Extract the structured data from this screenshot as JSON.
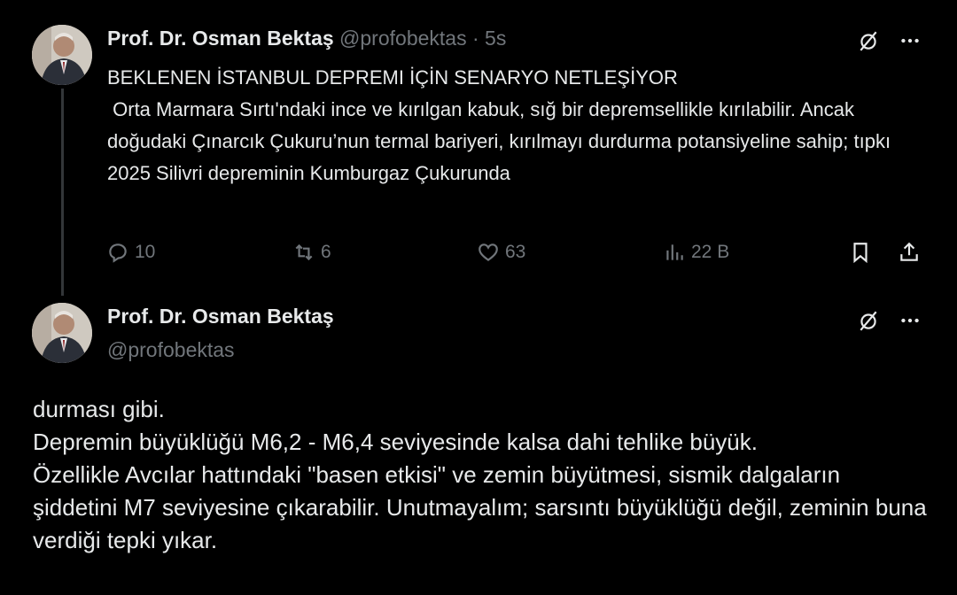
{
  "tweet1": {
    "author_name": "Prof. Dr. Osman Bektaş",
    "author_handle": "@profobektas",
    "separator": "·",
    "time": "5s",
    "title": "BEKLENEN İSTANBUL DEPREMI İÇİN SENARYO NETLEŞİYOR",
    "body": " Orta Marmara Sırtı'ndaki ince ve kırılgan kabuk, sığ bir depremsellikle kırılabilir. Ancak doğudaki Çınarcık Çukuru’nun termal bariyeri, kırılmayı durdurma potansiyeline sahip; tıpkı 2025 Silivri depreminin Kumburgaz Çukurunda",
    "replies": "10",
    "reposts": "6",
    "likes": "63",
    "views": "22 B"
  },
  "tweet2": {
    "author_name": "Prof. Dr. Osman Bektaş",
    "author_handle": "@profobektas",
    "body": "durması gibi.\nDepremin büyüklüğü M6,2 - M6,4 seviyesinde kalsa dahi tehlike büyük.\nÖzellikle Avcılar hattındaki \"basen etkisi\" ve zemin büyütmesi, sismik dalgaların şiddetini M7 seviyesine çıkarabilir. Unutmayalım; sarsıntı büyüklüğü değil, zeminin buna verdiği tepki yıkar."
  },
  "icons": {
    "grok": "grok-slash-icon",
    "more": "more-dots-icon",
    "reply": "reply-bubble-icon",
    "repost": "repost-icon",
    "like": "heart-icon",
    "views": "views-bars-icon",
    "bookmark": "bookmark-icon",
    "share": "share-icon"
  },
  "colors": {
    "background": "#000000",
    "text": "#e7e9ea",
    "muted": "#71767b",
    "thread_line": "#333639"
  }
}
